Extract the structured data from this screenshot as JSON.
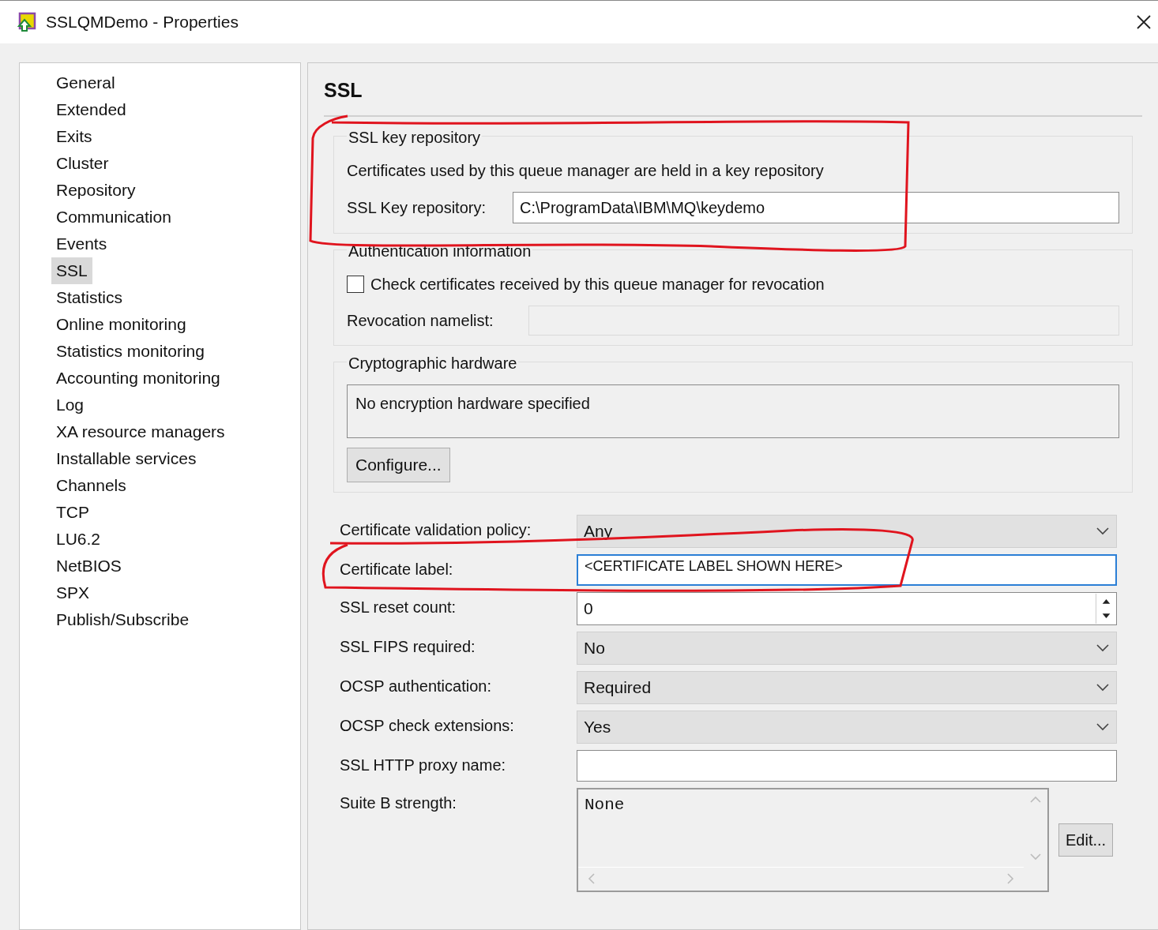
{
  "window": {
    "title": "SSLQMDemo - Properties"
  },
  "nav": {
    "items": [
      {
        "label": "General",
        "selected": false
      },
      {
        "label": "Extended",
        "selected": false
      },
      {
        "label": "Exits",
        "selected": false
      },
      {
        "label": "Cluster",
        "selected": false
      },
      {
        "label": "Repository",
        "selected": false
      },
      {
        "label": "Communication",
        "selected": false
      },
      {
        "label": "Events",
        "selected": false
      },
      {
        "label": "SSL",
        "selected": true
      },
      {
        "label": "Statistics",
        "selected": false
      },
      {
        "label": "Online monitoring",
        "selected": false
      },
      {
        "label": "Statistics monitoring",
        "selected": false
      },
      {
        "label": "Accounting monitoring",
        "selected": false
      },
      {
        "label": "Log",
        "selected": false
      },
      {
        "label": "XA resource managers",
        "selected": false
      },
      {
        "label": "Installable services",
        "selected": false
      },
      {
        "label": "Channels",
        "selected": false
      },
      {
        "label": "TCP",
        "selected": false
      },
      {
        "label": "LU6.2",
        "selected": false
      },
      {
        "label": "NetBIOS",
        "selected": false
      },
      {
        "label": "SPX",
        "selected": false
      },
      {
        "label": "Publish/Subscribe",
        "selected": false
      }
    ]
  },
  "page": {
    "title": "SSL"
  },
  "key_repository": {
    "legend": "SSL key repository",
    "description": "Certificates used by this queue manager are held in a key repository",
    "label": "SSL Key repository:",
    "value": "C:\\ProgramData\\IBM\\MQ\\keydemo"
  },
  "authentication": {
    "legend": "Authentication information",
    "checkbox": {
      "label": "Check certificates received by this queue manager for revocation",
      "checked": false
    },
    "namelist_label": "Revocation namelist:",
    "namelist_disabled": true
  },
  "crypto": {
    "legend": "Cryptographic hardware",
    "value": "No encryption hardware specified",
    "button": "Configure..."
  },
  "settings": [
    {
      "kind": "select",
      "label": "Certificate validation policy:",
      "value": "Any"
    },
    {
      "kind": "text",
      "label": "Certificate label:",
      "value": "<CERTIFICATE LABEL SHOWN HERE>",
      "focused": true
    },
    {
      "kind": "spinner",
      "label": "SSL reset count:",
      "value": "0"
    },
    {
      "kind": "select",
      "label": "SSL FIPS required:",
      "value": "No"
    },
    {
      "kind": "select",
      "label": "OCSP authentication:",
      "value": "Required"
    },
    {
      "kind": "select",
      "label": "OCSP check extensions:",
      "value": "Yes"
    },
    {
      "kind": "text",
      "label": "SSL HTTP proxy name:",
      "focused": false
    },
    {
      "kind": "listbox",
      "label": "Suite B strength:",
      "value": "None",
      "button": "Edit..."
    }
  ]
}
